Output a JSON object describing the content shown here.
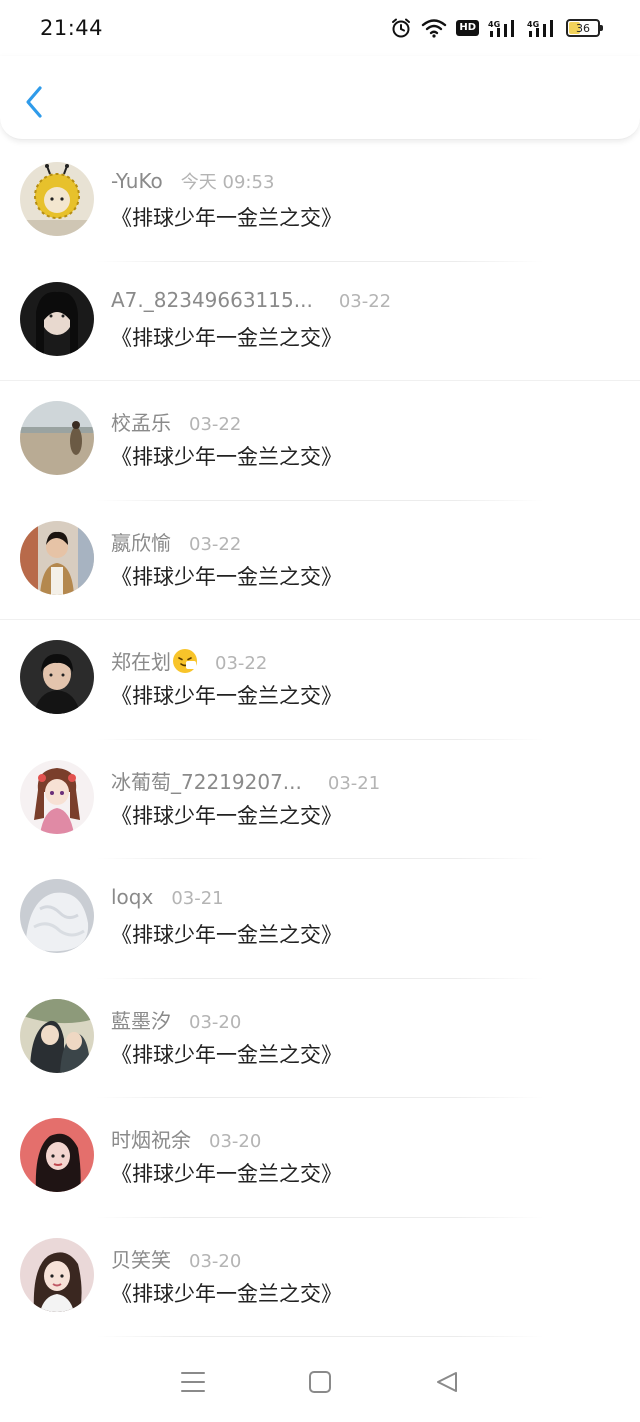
{
  "status_bar": {
    "time": "21:44",
    "icons": [
      "alarm-icon",
      "wifi-icon",
      "hd-icon",
      "signal-4g-icon",
      "signal-4g-icon",
      "battery-icon"
    ],
    "hd_label": "HD",
    "battery_level": "36"
  },
  "header": {
    "back_icon": "chevron-left-icon",
    "accent_color": "#2f9bea"
  },
  "list": {
    "items": [
      {
        "name": "-YuKo",
        "time": "今天 09:53",
        "message": "《排球少年一金兰之交》"
      },
      {
        "name": "A7._82349663115...",
        "time": "03-22",
        "message": "《排球少年一金兰之交》"
      },
      {
        "name": "校孟乐",
        "time": "03-22",
        "message": "《排球少年一金兰之交》"
      },
      {
        "name": "嬴欣愉",
        "time": "03-22",
        "message": "《排球少年一金兰之交》"
      },
      {
        "name": "郑在划",
        "time": "03-22",
        "message": "《排球少年一金兰之交》"
      },
      {
        "name": "冰葡萄_72219207...",
        "time": "03-21",
        "message": "《排球少年一金兰之交》"
      },
      {
        "name": "loqx",
        "time": "03-21",
        "message": "《排球少年一金兰之交》"
      },
      {
        "name": "藍墨汐",
        "time": "03-20",
        "message": "《排球少年一金兰之交》"
      },
      {
        "name": "时烟祝余",
        "time": "03-20",
        "message": "《排球少年一金兰之交》"
      },
      {
        "name": "贝笑笑",
        "time": "03-20",
        "message": "《排球少年一金兰之交》"
      }
    ]
  },
  "nav_bar": {
    "icons": [
      "menu-icon",
      "home-square-icon",
      "back-triangle-icon"
    ]
  }
}
